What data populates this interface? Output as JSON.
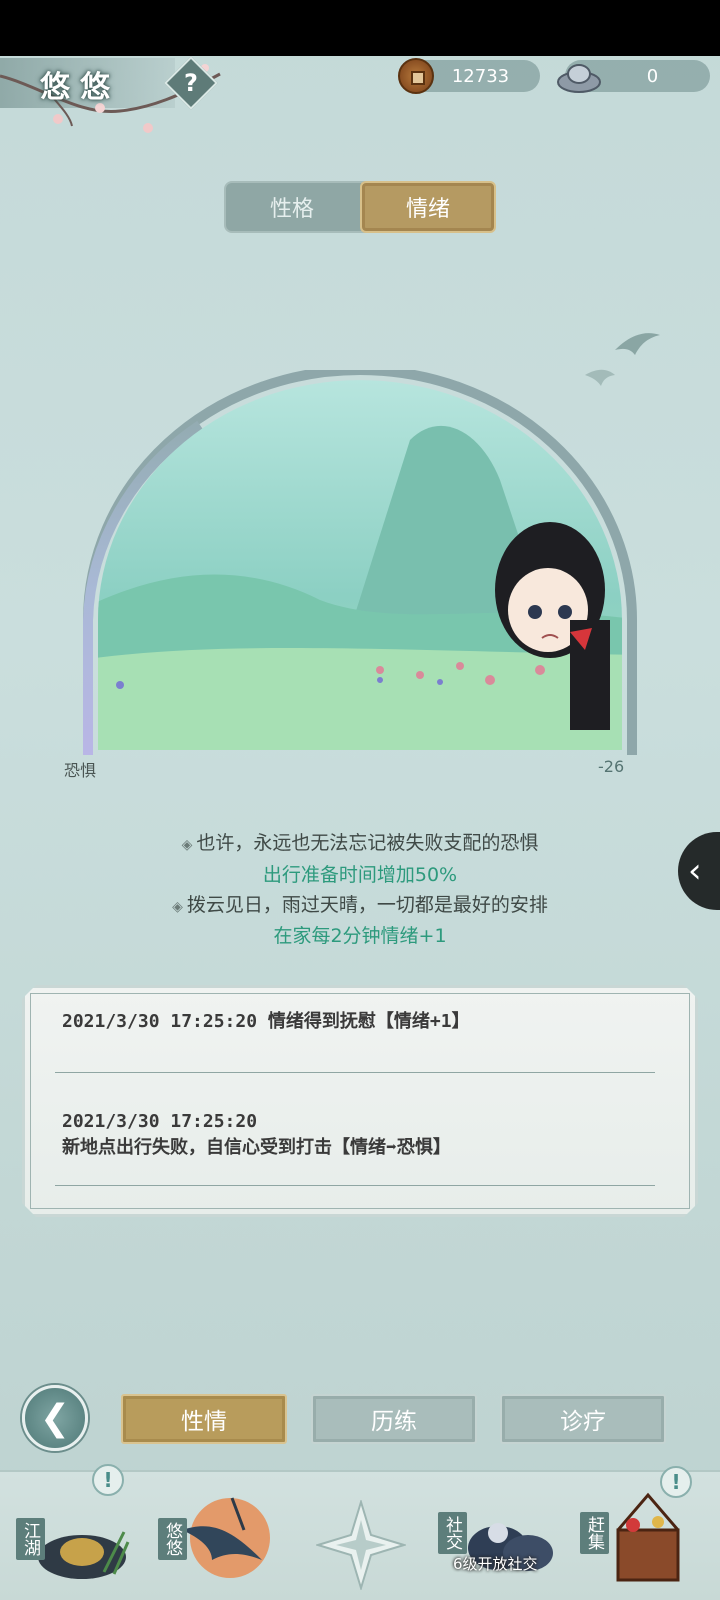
{
  "header": {
    "character_name": "悠悠",
    "help_label": "?",
    "copper_coins": "12733",
    "silver_ingots": "0"
  },
  "top_tabs": [
    {
      "label": "性格",
      "selected": false
    },
    {
      "label": "情绪",
      "selected": true
    }
  ],
  "emotion_meter": {
    "state_label": "恐惧",
    "value": "-26"
  },
  "descriptions": [
    {
      "text": "也许，永远也无法忘记被失败支配的恐惧",
      "effect": "出行准备时间增加50%"
    },
    {
      "text": "拨云见日，雨过天晴，一切都是最好的安排",
      "effect": "在家每2分钟情绪+1"
    }
  ],
  "log": [
    {
      "line1": "2021/3/30 17:25:20 情绪得到抚慰【情绪+1】",
      "line2": ""
    },
    {
      "line1": "2021/3/30 17:25:20",
      "line2": "新地点出行失败，自信心受到打击【情绪➡恐惧】"
    }
  ],
  "bottom_tabs": [
    {
      "label": "性情",
      "selected": true
    },
    {
      "label": "历练",
      "selected": false
    },
    {
      "label": "诊疗",
      "selected": false
    }
  ],
  "nav": {
    "items": [
      {
        "label": "江湖",
        "badge": "!"
      },
      {
        "label": "悠悠"
      },
      {
        "label": "社交",
        "locked_text": "6级开放社交"
      },
      {
        "label": "赶集",
        "badge": "!"
      }
    ]
  },
  "colors": {
    "selected_tab": "#b59a62",
    "effect_text": "#2d9a7d",
    "background": "#c6dbd9"
  }
}
